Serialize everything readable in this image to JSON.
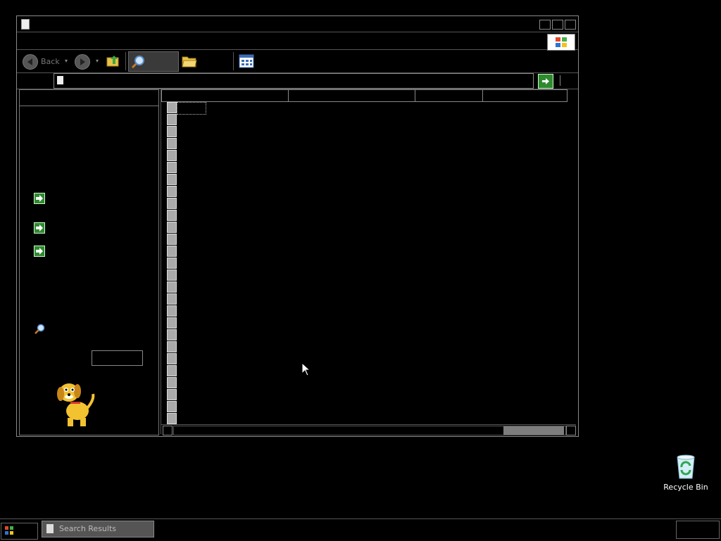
{
  "window": {
    "title": "",
    "toolbar": {
      "back_label": "Back",
      "search_label": "",
      "views_label": ""
    },
    "address": {
      "value": ""
    }
  },
  "left_pane": {
    "header": "",
    "links": [
      {
        "label": ""
      },
      {
        "label": ""
      },
      {
        "label": ""
      }
    ]
  },
  "list": {
    "columns": [
      "",
      "",
      "",
      ""
    ],
    "rows": [
      "",
      "",
      "",
      "",
      "",
      "",
      "",
      "",
      "",
      "",
      "",
      "",
      "",
      "",
      "",
      "",
      "",
      "",
      "",
      "",
      "",
      "",
      "",
      "",
      "",
      "",
      ""
    ]
  },
  "desktop": {
    "recycle_bin_label": "Recycle Bin"
  },
  "taskbar": {
    "start_label": "",
    "task_label": "Search Results"
  }
}
